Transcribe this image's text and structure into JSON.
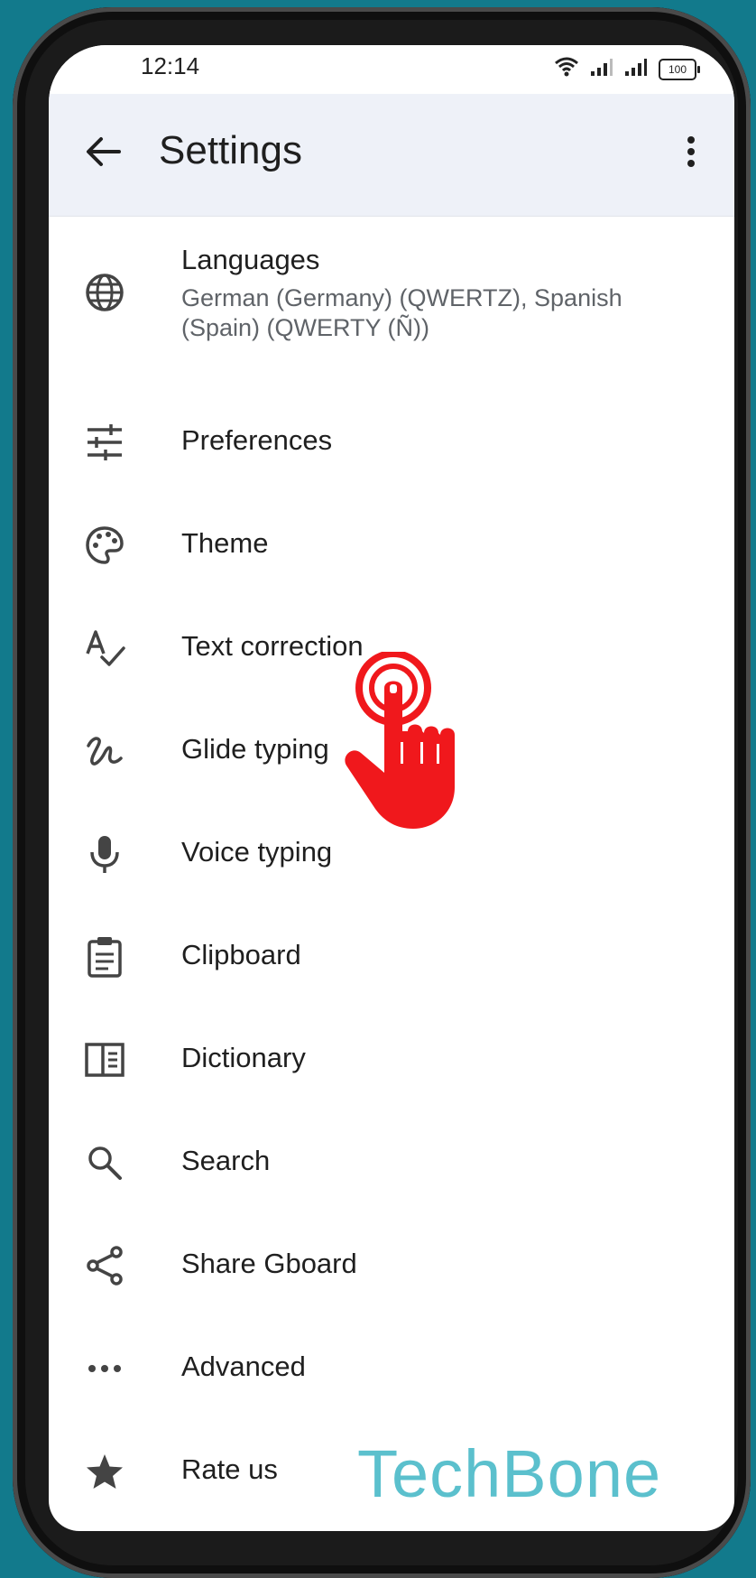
{
  "status_bar": {
    "time": "12:14",
    "battery": "100"
  },
  "header": {
    "title": "Settings",
    "back_icon": "arrow-back-icon",
    "more_icon": "more-vert-icon"
  },
  "settings": {
    "items": [
      {
        "label": "Languages",
        "sublabel": "German (Germany) (QWERTZ), Spanish (Spain) (QWERTY (Ñ))",
        "icon": "globe-icon"
      },
      {
        "label": "Preferences",
        "icon": "tune-icon"
      },
      {
        "label": "Theme",
        "icon": "palette-icon"
      },
      {
        "label": "Text correction",
        "icon": "spellcheck-icon"
      },
      {
        "label": "Glide typing",
        "icon": "gesture-icon"
      },
      {
        "label": "Voice typing",
        "icon": "microphone-icon"
      },
      {
        "label": "Clipboard",
        "icon": "clipboard-icon"
      },
      {
        "label": "Dictionary",
        "icon": "book-icon"
      },
      {
        "label": "Search",
        "icon": "search-icon"
      },
      {
        "label": "Share Gboard",
        "icon": "share-icon"
      },
      {
        "label": "Advanced",
        "icon": "more-horiz-icon"
      },
      {
        "label": "Rate us",
        "icon": "star-icon"
      }
    ]
  },
  "overlay": {
    "watermark": "TechBone",
    "tap_indicator_color": "#f0181c"
  },
  "colors": {
    "background": "#127a8c",
    "app_bar": "#eef1f8",
    "watermark": "#5bc0cd"
  }
}
